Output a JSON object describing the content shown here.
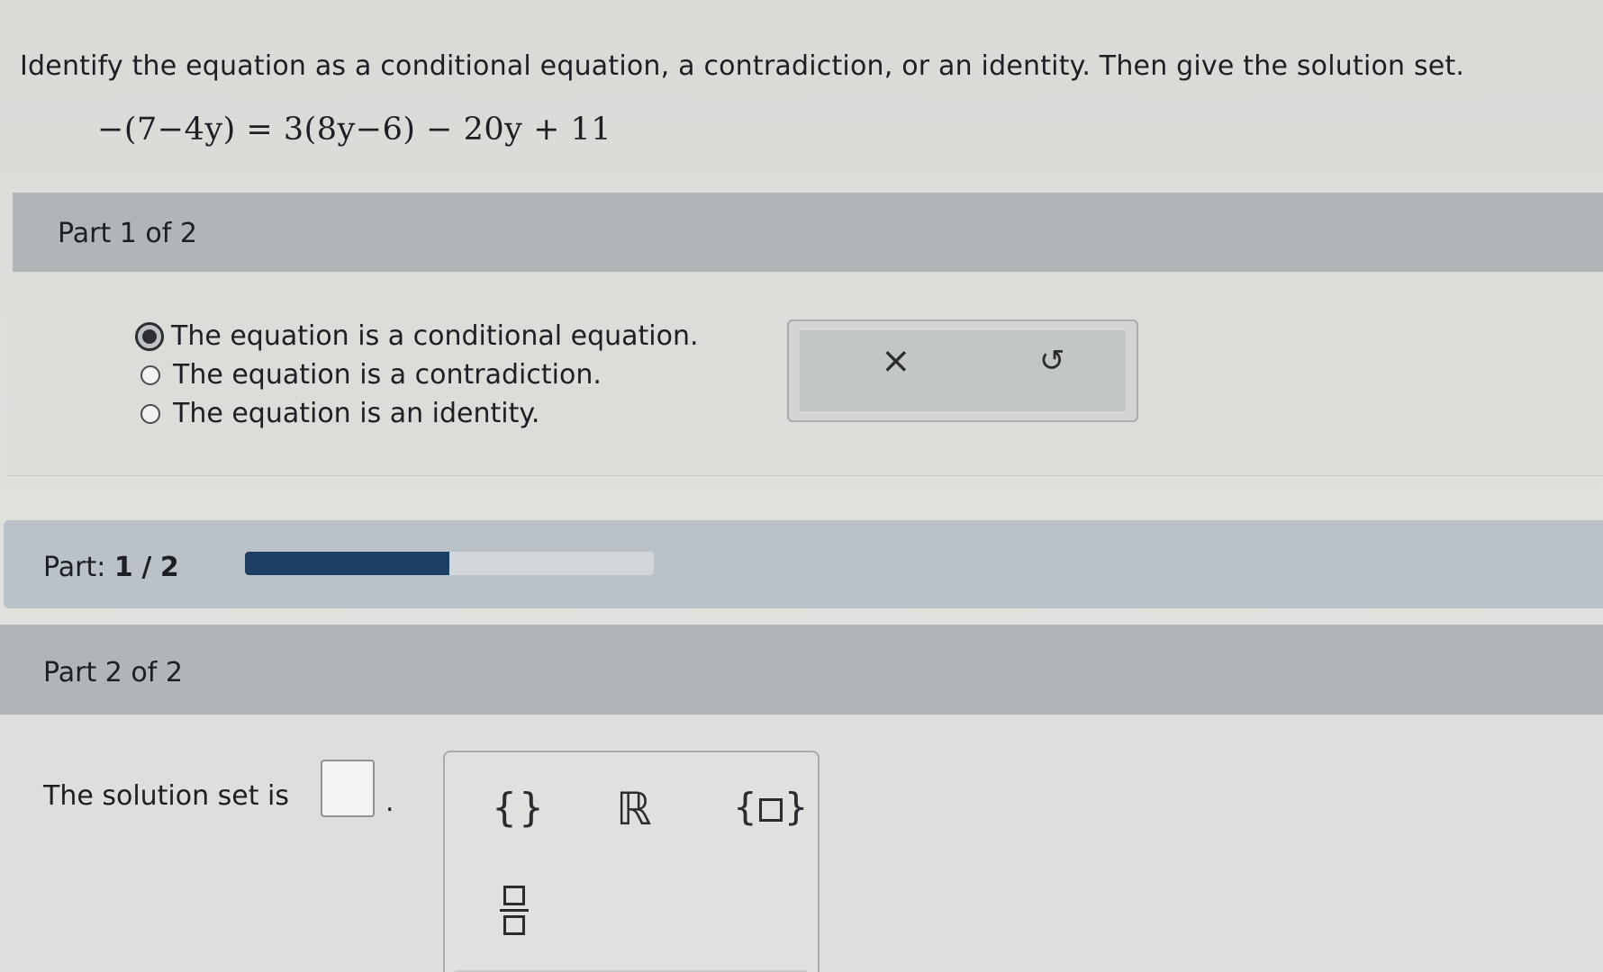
{
  "question": {
    "text": "Identify the equation as a conditional equation, a contradiction, or an identity. Then give the solution set.",
    "equation": "−(7−4y) = 3(8y−6) − 20y + 11"
  },
  "part1": {
    "header": "Part 1 of 2",
    "options": [
      {
        "label": "The equation is a conditional equation.",
        "selected": true
      },
      {
        "label": "The equation is a contradiction.",
        "selected": false
      },
      {
        "label": "The equation is an identity.",
        "selected": false
      }
    ],
    "tools": {
      "clear_glyph": "×",
      "undo_glyph": "↺"
    }
  },
  "progress": {
    "label": "Part:",
    "current": "1",
    "separator": "/",
    "total": "2",
    "fraction": 0.5
  },
  "part2": {
    "header": "Part 2 of 2",
    "solution_label": "The solution set is",
    "period": ".",
    "palette": {
      "empty_set": "{}",
      "reals": "ℝ",
      "set_open": "{",
      "set_close": "}"
    }
  }
}
